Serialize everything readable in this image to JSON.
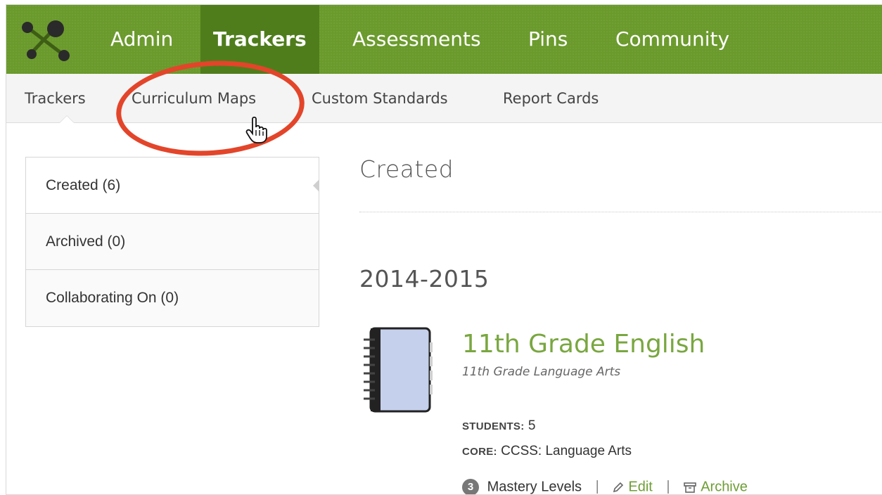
{
  "topnav": {
    "items": [
      {
        "label": "Admin"
      },
      {
        "label": "Trackers",
        "active": true
      },
      {
        "label": "Assessments"
      },
      {
        "label": "Pins"
      },
      {
        "label": "Community"
      }
    ],
    "logo_icon": "network-dots-logo",
    "color": "#6a9a2c",
    "active_color": "#4f7d1c"
  },
  "subnav": {
    "items": [
      {
        "label": "Trackers",
        "active": true
      },
      {
        "label": "Curriculum Maps"
      },
      {
        "label": "Custom Standards"
      },
      {
        "label": "Report Cards"
      }
    ],
    "highlight_color": "#e3452a"
  },
  "sidebar": {
    "items": [
      {
        "label": "Created (6)",
        "active": true
      },
      {
        "label": "Archived (0)"
      },
      {
        "label": "Collaborating On (0)"
      }
    ]
  },
  "main": {
    "section_title": "Created",
    "year": "2014-2015",
    "tracker": {
      "title": "11th Grade English",
      "subtitle": "11th Grade Language Arts",
      "students_label": "STUDENTS:",
      "students_value": "5",
      "core_label": "CORE:",
      "core_value": "CCSS: Language Arts",
      "mastery_count": "3",
      "mastery_label": "Mastery Levels",
      "edit_label": "Edit",
      "archive_label": "Archive",
      "title_color": "#79a740"
    }
  }
}
